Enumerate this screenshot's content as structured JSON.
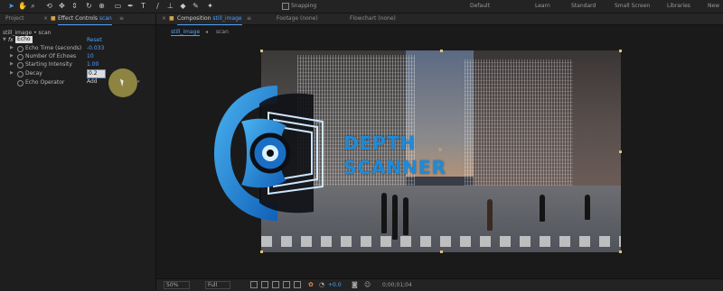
{
  "toolbar": {
    "snapping_label": "Snapping",
    "workspaces": [
      "Default",
      "Learn",
      "Standard",
      "Small Screen",
      "Libraries",
      "New"
    ]
  },
  "left_panel": {
    "tabs": {
      "project": "Project",
      "effect_controls_prefix": "Effect Controls",
      "effect_controls_layer": "scan"
    },
    "breadcrumb": "still_image • scan",
    "effect": {
      "fx_badge": "fx",
      "name": "Echo",
      "reset_label": "Reset",
      "properties": [
        {
          "label": "Echo Time (seconds)",
          "value": "-0.033"
        },
        {
          "label": "Number Of Echoes",
          "value": "10"
        },
        {
          "label": "Starting Intensity",
          "value": "1.00"
        },
        {
          "label": "Decay",
          "value": "0.2"
        },
        {
          "label": "Echo Operator",
          "value": "Add"
        }
      ]
    }
  },
  "right_panel": {
    "tabs": {
      "composition_prefix": "Composition",
      "composition_name": "still_image",
      "footage": "Footage (none)",
      "flowchart": "Flowchart (none)"
    },
    "subtabs": [
      "still_image",
      "scan"
    ],
    "overlay": {
      "line1": "DEPTH",
      "line2": "SCANNER"
    },
    "bottom_bar": {
      "zoom": "50%",
      "resolution": "Full",
      "exposure": "+0.0",
      "timecode": "0;00;01;04"
    }
  },
  "colors": {
    "accent": "#4ea0ff",
    "brand": "#1f8ad8"
  }
}
